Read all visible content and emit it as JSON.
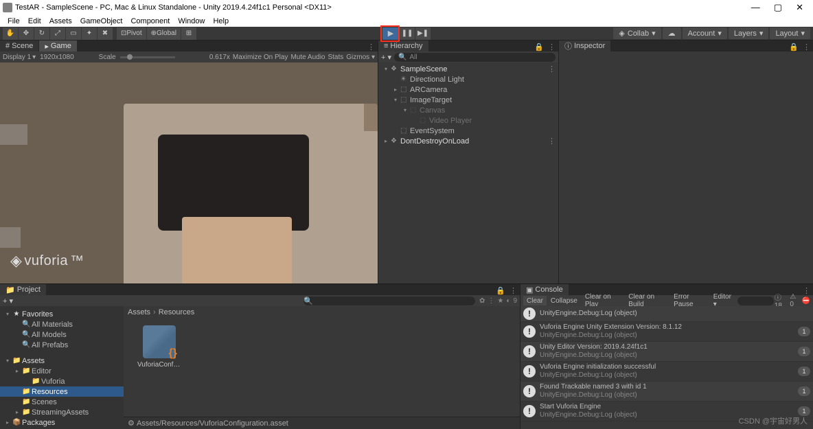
{
  "title": "TestAR - SampleScene - PC, Mac & Linux Standalone - Unity 2019.4.24f1c1 Personal <DX11>",
  "menu": [
    "File",
    "Edit",
    "Assets",
    "GameObject",
    "Component",
    "Window",
    "Help"
  ],
  "toolbar": {
    "pivot": "Pivot",
    "global": "Global"
  },
  "topRight": {
    "collab": "Collab",
    "account": "Account",
    "layers": "Layers",
    "layout": "Layout"
  },
  "tabs": {
    "scene": "Scene",
    "game": "Game",
    "hierarchy": "Hierarchy",
    "inspector": "Inspector",
    "project": "Project",
    "console": "Console"
  },
  "gameBar": {
    "display": "Display 1",
    "res": "1920x1080",
    "scaleLbl": "Scale",
    "scaleVal": "0.617x",
    "maximize": "Maximize On Play",
    "muteAudio": "Mute Audio",
    "stats": "Stats",
    "gizmos": "Gizmos"
  },
  "vuforia": "vuforia",
  "hierarchy": {
    "searchPlaceholder": "All",
    "items": [
      {
        "t": "scene",
        "label": "SampleScene",
        "indent": 0,
        "arrow": "▾",
        "ic": "❖",
        "opts": "⋮"
      },
      {
        "t": "go",
        "label": "Directional Light",
        "indent": 1,
        "arrow": "",
        "ic": "☀"
      },
      {
        "t": "go",
        "label": "ARCamera",
        "indent": 1,
        "arrow": "▸",
        "ic": "⬚"
      },
      {
        "t": "go",
        "label": "ImageTarget",
        "indent": 1,
        "arrow": "▾",
        "ic": "⬚"
      },
      {
        "t": "dim",
        "label": "Canvas",
        "indent": 2,
        "arrow": "▾",
        "ic": "⬚"
      },
      {
        "t": "dim",
        "label": "Video Player",
        "indent": 3,
        "arrow": "",
        "ic": "⬚"
      },
      {
        "t": "go",
        "label": "EventSystem",
        "indent": 1,
        "arrow": "",
        "ic": "⬚"
      },
      {
        "t": "scene",
        "label": "DontDestroyOnLoad",
        "indent": 0,
        "arrow": "▸",
        "ic": "❖",
        "opts": "⋮"
      }
    ]
  },
  "project": {
    "tree": [
      {
        "t": "hdr",
        "label": "Favorites",
        "indent": 0,
        "arrow": "▾",
        "ic": "★"
      },
      {
        "t": "",
        "label": "All Materials",
        "indent": 1,
        "arrow": "",
        "ic": "🔍"
      },
      {
        "t": "",
        "label": "All Models",
        "indent": 1,
        "arrow": "",
        "ic": "🔍"
      },
      {
        "t": "",
        "label": "All Prefabs",
        "indent": 1,
        "arrow": "",
        "ic": "🔍"
      },
      {
        "t": "sp",
        "label": "",
        "indent": 0,
        "arrow": "",
        "ic": ""
      },
      {
        "t": "hdr",
        "label": "Assets",
        "indent": 0,
        "arrow": "▾",
        "ic": "📁"
      },
      {
        "t": "",
        "label": "Editor",
        "indent": 1,
        "arrow": "▸",
        "ic": "📁"
      },
      {
        "t": "",
        "label": "Vuforia",
        "indent": 2,
        "arrow": "",
        "ic": "📁"
      },
      {
        "t": "sel",
        "label": "Resources",
        "indent": 1,
        "arrow": "",
        "ic": "📁"
      },
      {
        "t": "",
        "label": "Scenes",
        "indent": 1,
        "arrow": "",
        "ic": "📁"
      },
      {
        "t": "",
        "label": "StreamingAssets",
        "indent": 1,
        "arrow": "▸",
        "ic": "📁"
      },
      {
        "t": "hdr",
        "label": "Packages",
        "indent": 0,
        "arrow": "▸",
        "ic": "📦"
      }
    ],
    "breadcrumb": [
      "Assets",
      "Resources"
    ],
    "asset": {
      "name": "VuforiaConfigurat..."
    },
    "footerIcon": "⚙",
    "footer": "Assets/Resources/VuforiaConfiguration.asset",
    "toolbarBtns": [
      "✿",
      "⋮",
      "★",
      "◐",
      "9"
    ]
  },
  "console": {
    "buttons": [
      "Clear",
      "Collapse",
      "Clear on Play",
      "Clear on Build",
      "Error Pause",
      "Editor ▾"
    ],
    "stats": {
      "info": "18",
      "warn": "0",
      "err": ""
    },
    "logs": [
      {
        "msg": "UnityEngine.Debug:Log (object)",
        "sub": "",
        "count": ""
      },
      {
        "msg": "Vuforia Engine Unity Extension Version: 8.1.12",
        "sub": "UnityEngine.Debug:Log (object)",
        "count": "1"
      },
      {
        "msg": "Unity Editor Version: 2019.4.24f1c1",
        "sub": "UnityEngine.Debug:Log (object)",
        "count": "1"
      },
      {
        "msg": "Vuforia Engine initialization successful",
        "sub": "UnityEngine.Debug:Log (object)",
        "count": "1"
      },
      {
        "msg": "Found Trackable named 3 with id 1",
        "sub": "UnityEngine.Debug:Log (object)",
        "count": "1"
      },
      {
        "msg": "Start Vuforia Engine",
        "sub": "UnityEngine.Debug:Log (object)",
        "count": "1"
      }
    ]
  },
  "watermark": "CSDN @宇宙好男人"
}
